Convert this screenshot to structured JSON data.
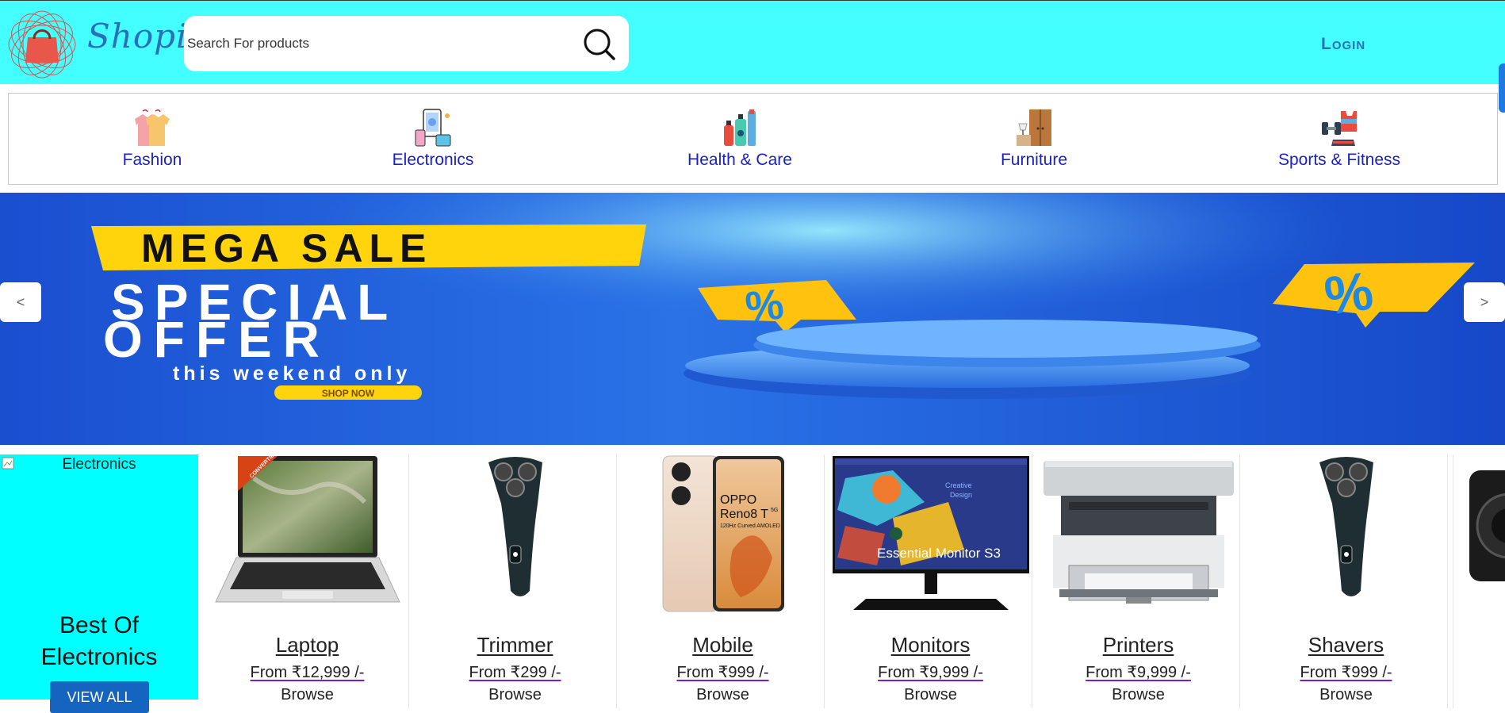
{
  "header": {
    "brand": "ShopiT",
    "search_placeholder": "Search For products",
    "login_label": "Login"
  },
  "categories": [
    {
      "label": "Fashion",
      "icon": "shirts-icon"
    },
    {
      "label": "Electronics",
      "icon": "devices-icon"
    },
    {
      "label": "Health & Care",
      "icon": "toiletries-icon"
    },
    {
      "label": "Furniture",
      "icon": "furniture-icon"
    },
    {
      "label": "Sports & Fitness",
      "icon": "dumbbell-icon"
    }
  ],
  "banner": {
    "line1": "MEGA SALE",
    "line2": "SPECIAL",
    "line3": "OFFER",
    "line4": "this weekend only",
    "cta": "SHOP NOW",
    "prev_label": "<",
    "next_label": ">",
    "percent": "%"
  },
  "promo": {
    "image_alt": "Electronics",
    "title_line1": "Best Of",
    "title_line2": "Electronics",
    "button_label": "VIEW ALL"
  },
  "products": [
    {
      "name": "Laptop",
      "price": "From ₹12,999 /-",
      "action": "Browse"
    },
    {
      "name": "Trimmer",
      "price": "From ₹299 /-",
      "action": "Browse"
    },
    {
      "name": "Mobile",
      "price": "From ₹999 /-",
      "action": "Browse"
    },
    {
      "name": "Monitors",
      "price": "From ₹9,999 /-",
      "action": "Browse"
    },
    {
      "name": "Printers",
      "price": "From ₹9,999 /-",
      "action": "Browse"
    },
    {
      "name": "Shavers",
      "price": "From ₹999 /-",
      "action": "Browse"
    }
  ],
  "product_image_text": {
    "laptop_badge": "CONVERTIBLE",
    "mobile_brand": "OPPO",
    "mobile_model": "Reno8 T",
    "mobile_5g": "5G",
    "mobile_tagline": "120Hz Curved AMOLED",
    "monitor_caption": "Essential Monitor S3",
    "monitor_sub1": "Creative",
    "monitor_sub2": "Design"
  },
  "colors": {
    "header_bg": "#43ffff",
    "brand": "#2a6fb8",
    "category_text": "#1a1fc8",
    "promo_bg": "#00ffff",
    "button_blue": "#1565c0"
  }
}
